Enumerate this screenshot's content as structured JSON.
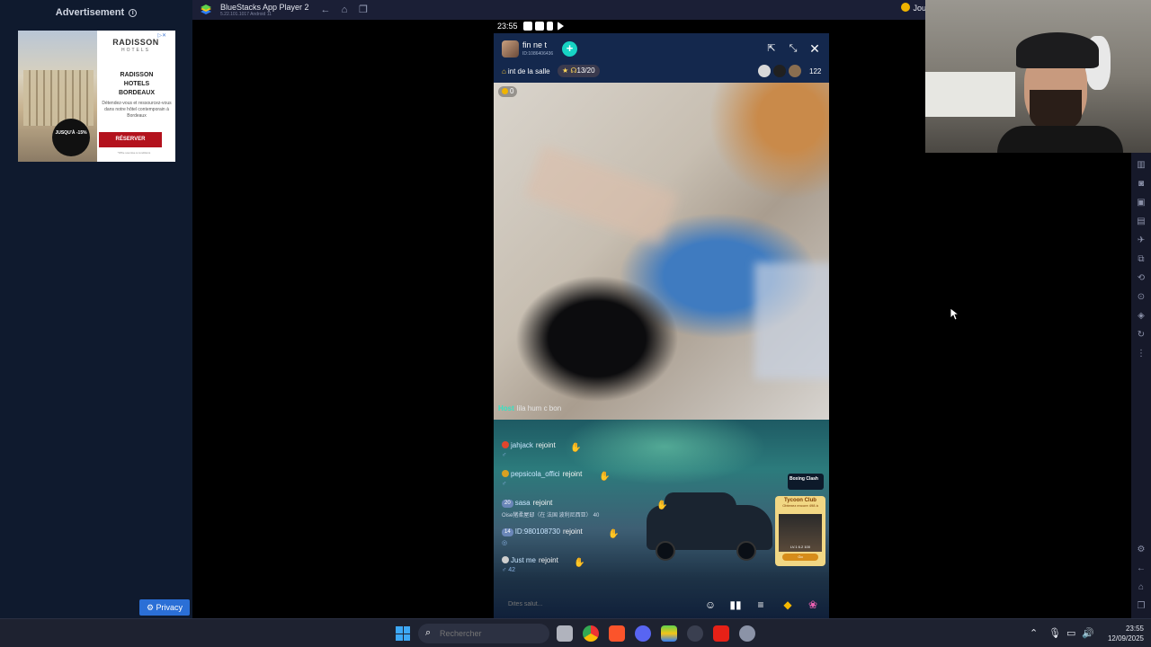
{
  "ad": {
    "label": "Advertisement",
    "brand": "RADISSON",
    "brand_sub": "HOTELS",
    "title_line1": "RADISSON",
    "title_line2": "HOTELS",
    "title_line3": "BORDEAUX",
    "desc": "Détendez-vous et ressourcez-vous dans notre hôtel contemporain à Bordeaux",
    "badge": "JUSQU'À -15%",
    "cta": "RÉSERVER",
    "fine": "*Offre soumise à conditions",
    "privacy": "Privacy"
  },
  "bluestacks": {
    "title": "BlueStacks App Player 2",
    "version": "5.22.101.1017 Android 11",
    "right_label": "Jou"
  },
  "android": {
    "time": "23:55"
  },
  "room": {
    "name": "fin ne t",
    "id": "ID:1086406436",
    "tag": "int de la salle",
    "seats": "13/20",
    "viewers": "122",
    "coins": "0",
    "host_label": "Host",
    "host_msg": "lila hum c bon"
  },
  "chat": [
    {
      "user": "jahjack",
      "action": "rejoint",
      "sub": "♂",
      "level": ""
    },
    {
      "user": "pepsicola_offici",
      "action": "rejoint",
      "sub": "♂",
      "level": ""
    },
    {
      "user": "sasa",
      "action": "rejoint",
      "sub": "Oise猪柔屋邸（在 法国 波利尼西亚）",
      "sub_count": "40",
      "level": "20"
    },
    {
      "user": "ID:980108730",
      "action": "rejoint",
      "sub": "◎",
      "level": "14"
    },
    {
      "user": "Just me",
      "action": "rejoint",
      "sub": "♂ 42",
      "level": ""
    }
  ],
  "side": {
    "boxing": "Boxing Clash",
    "tycoon_title": "Tycoon Club",
    "tycoon_sub": "Obtenez encore 498 à",
    "tycoon_val": "LV.1   6.2 100",
    "tycoon_btn": "Go"
  },
  "input": {
    "placeholder": "Dites salut..."
  },
  "taskbar": {
    "search_placeholder": "Rechercher",
    "time": "23:55",
    "date": "12/09/2025"
  }
}
